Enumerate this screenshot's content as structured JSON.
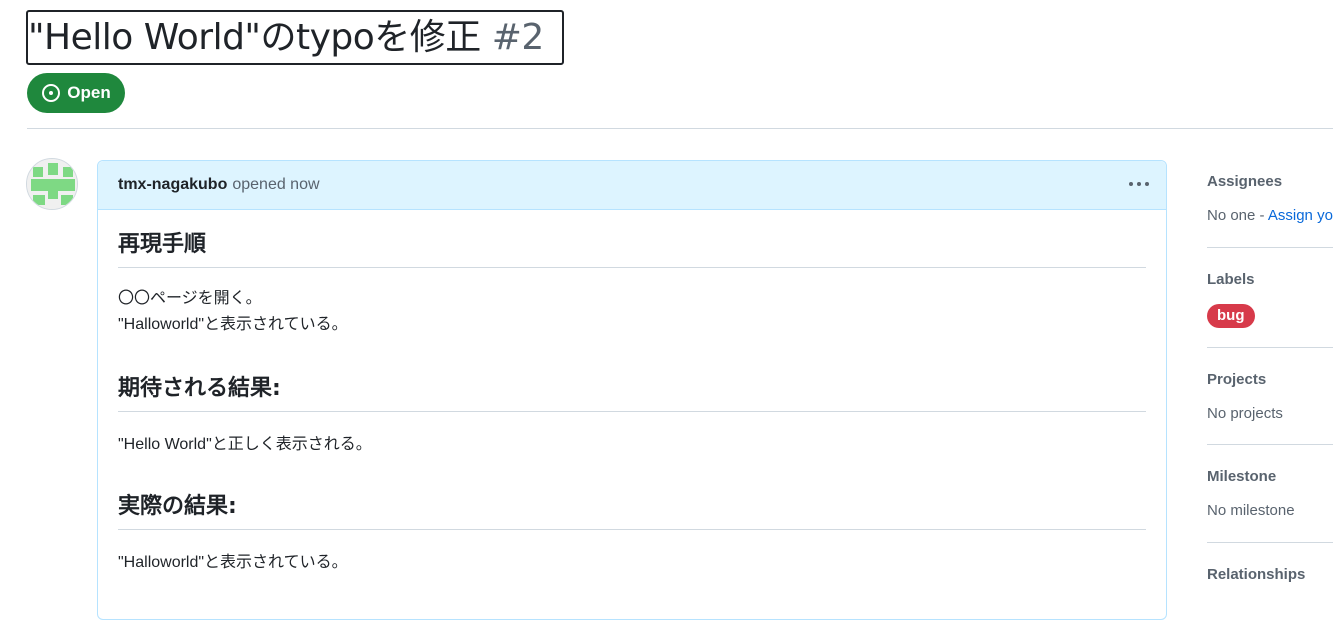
{
  "issue": {
    "title": "\"Hello World\"のtypoを修正",
    "number": "#2",
    "state_label": "Open",
    "state_color": "#1f883d"
  },
  "comment": {
    "author": "tmx-nagakubo",
    "meta": "opened now",
    "sections": [
      {
        "heading": "再現手順",
        "lines": [
          "〇〇ページを開く。",
          "\"Halloworld\"と表示されている。"
        ]
      },
      {
        "heading": "期待される結果:",
        "lines": [
          "\"Hello World\"と正しく表示される。"
        ]
      },
      {
        "heading": "実際の結果:",
        "lines": [
          "\"Halloworld\"と表示されている。"
        ]
      }
    ]
  },
  "sidebar": {
    "assignees": {
      "label": "Assignees",
      "value": "No one - ",
      "link": "Assign yo"
    },
    "labels": {
      "label": "Labels",
      "chip": "bug",
      "chip_color": "#d73a4a"
    },
    "projects": {
      "label": "Projects",
      "value": "No projects"
    },
    "milestone": {
      "label": "Milestone",
      "value": "No milestone"
    },
    "relationships": {
      "label": "Relationships"
    }
  }
}
